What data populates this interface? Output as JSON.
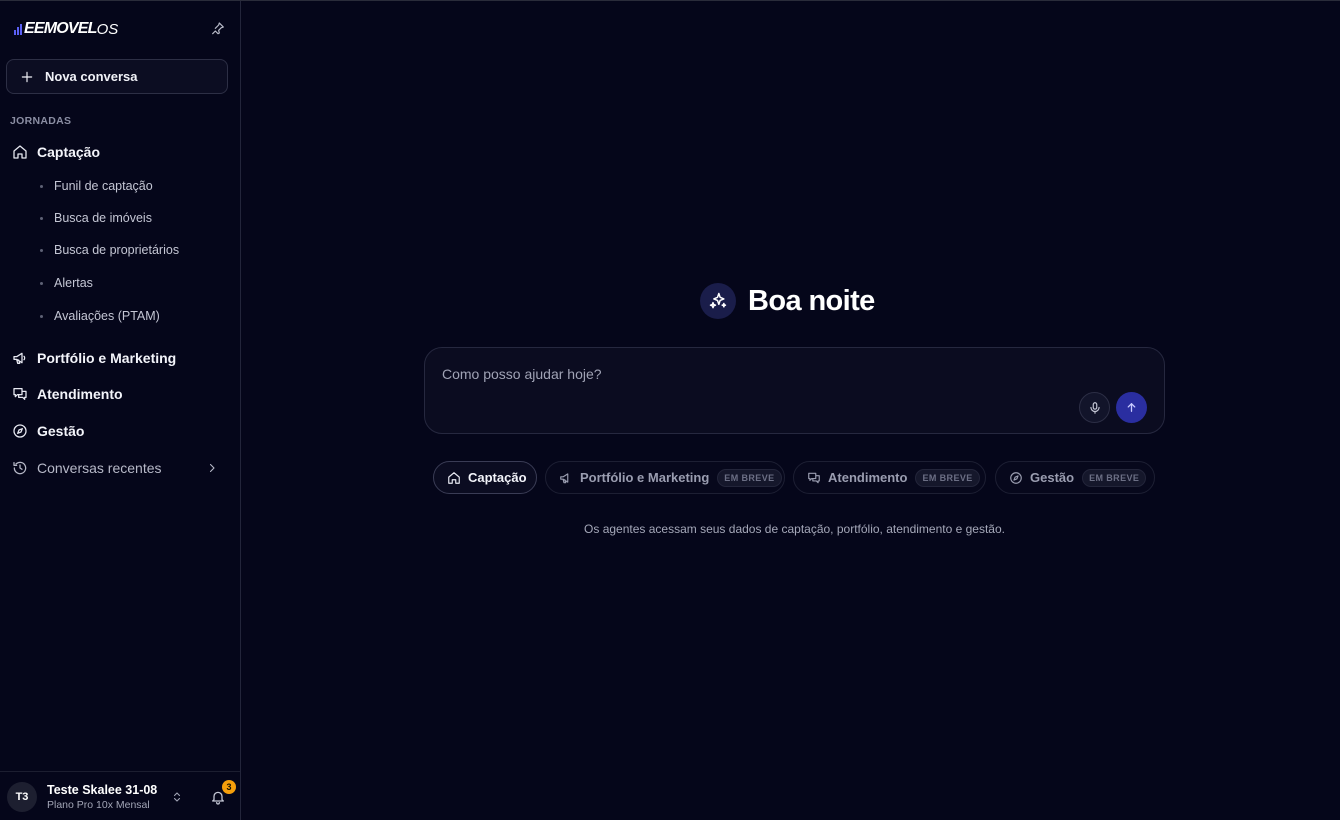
{
  "brand": {
    "name": "EEMOVEL",
    "suffix": "OS",
    "accent": "#5b5ff5"
  },
  "sidebar": {
    "new_chat_label": "Nova conversa",
    "section_title": "JORNADAS",
    "items": [
      {
        "label": "Captação",
        "icon": "home-icon"
      },
      {
        "label": "Portfólio e Marketing",
        "icon": "megaphone-icon"
      },
      {
        "label": "Atendimento",
        "icon": "chat-icon"
      },
      {
        "label": "Gestão",
        "icon": "compass-icon"
      },
      {
        "label": "Conversas recentes",
        "icon": "history-icon"
      }
    ],
    "captacao_sub": [
      {
        "label": "Funil de captação"
      },
      {
        "label": "Busca de imóveis"
      },
      {
        "label": "Busca de proprietários"
      },
      {
        "label": "Alertas"
      },
      {
        "label": "Avaliações (PTAM)"
      }
    ]
  },
  "user": {
    "initials": "T3",
    "name": "Teste Skalee 31-08",
    "plan": "Plano Pro 10x Mensal",
    "notifications": "3"
  },
  "main": {
    "greeting": "Boa noite",
    "input_placeholder": "Como posso ajudar hoje?",
    "chips": [
      {
        "label": "Captação",
        "icon": "home-icon",
        "active": true
      },
      {
        "label": "Portfólio e Marketing",
        "icon": "megaphone-icon",
        "badge": "EM BREVE"
      },
      {
        "label": "Atendimento",
        "icon": "chat-icon",
        "badge": "EM BREVE"
      },
      {
        "label": "Gestão",
        "icon": "compass-icon",
        "badge": "EM BREVE"
      }
    ],
    "footnote": "Os agentes acessam seus dados de captação, portfólio, atendimento e gestão."
  },
  "colors": {
    "background": "#05061a",
    "send_button": "#2a2ea0",
    "badge": "#f59e0b"
  }
}
